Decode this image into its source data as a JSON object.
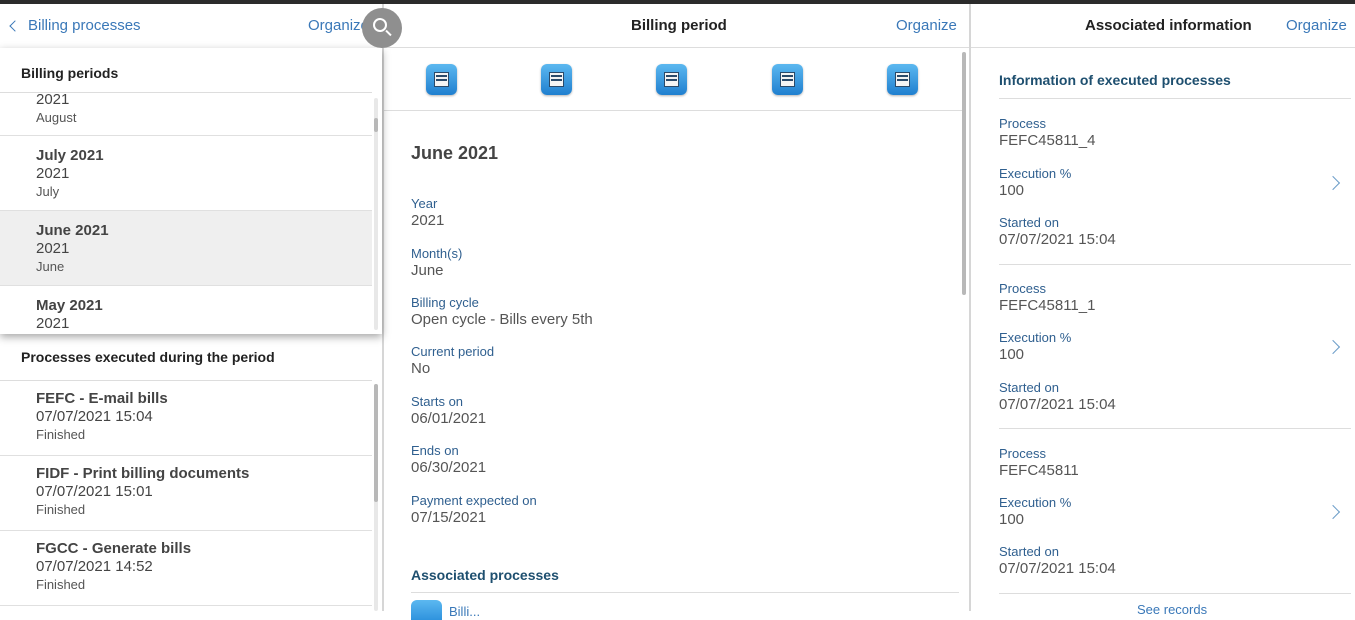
{
  "left": {
    "back_label": "Billing processes",
    "organize_label": "Organize",
    "periods_title": "Billing periods",
    "periods": [
      {
        "title": "",
        "year": "2021",
        "month": "August"
      },
      {
        "title": "July 2021",
        "year": "2021",
        "month": "July"
      },
      {
        "title": "June 2021",
        "year": "2021",
        "month": "June",
        "selected": true
      },
      {
        "title": "May 2021",
        "year": "2021",
        "month": ""
      }
    ],
    "processes_title": "Processes executed during the period",
    "processes": [
      {
        "title": "FEFC - E-mail bills",
        "datetime": "07/07/2021 15:04",
        "status": "Finished"
      },
      {
        "title": "FIDF - Print billing documents",
        "datetime": "07/07/2021 15:01",
        "status": "Finished"
      },
      {
        "title": "FGCC - Generate bills",
        "datetime": "07/07/2021 14:52",
        "status": "Finished"
      }
    ]
  },
  "center": {
    "title": "Billing period",
    "organize_label": "Organize",
    "toolbar_icons": [
      "print-icon",
      "document-download-icon",
      "printer-icon",
      "list-icon",
      "user-document-icon"
    ],
    "record_title": "June 2021",
    "fields": [
      {
        "label": "Year",
        "value": "2021"
      },
      {
        "label": "Month(s)",
        "value": "June"
      },
      {
        "label": "Billing cycle",
        "value": "Open cycle - Bills every 5th"
      },
      {
        "label": "Current period",
        "value": "No"
      },
      {
        "label": "Starts on",
        "value": "06/01/2021"
      },
      {
        "label": "Ends on",
        "value": "06/30/2021"
      },
      {
        "label": "Payment expected on",
        "value": "07/15/2021"
      }
    ],
    "associated_title": "Associated processes",
    "associated_first_label": "Billi..."
  },
  "right": {
    "title": "Associated information",
    "organize_label": "Organize",
    "section_title": "Information of executed processes",
    "process_label": "Process",
    "execution_label": "Execution %",
    "started_label": "Started on",
    "executions": [
      {
        "process": "FEFC45811_4",
        "execution": "100",
        "started": "07/07/2021 15:04"
      },
      {
        "process": "FEFC45811_1",
        "execution": "100",
        "started": "07/07/2021 15:04"
      },
      {
        "process": "FEFC45811",
        "execution": "100",
        "started": "07/07/2021 15:04"
      }
    ],
    "see_records_label": "See records"
  }
}
